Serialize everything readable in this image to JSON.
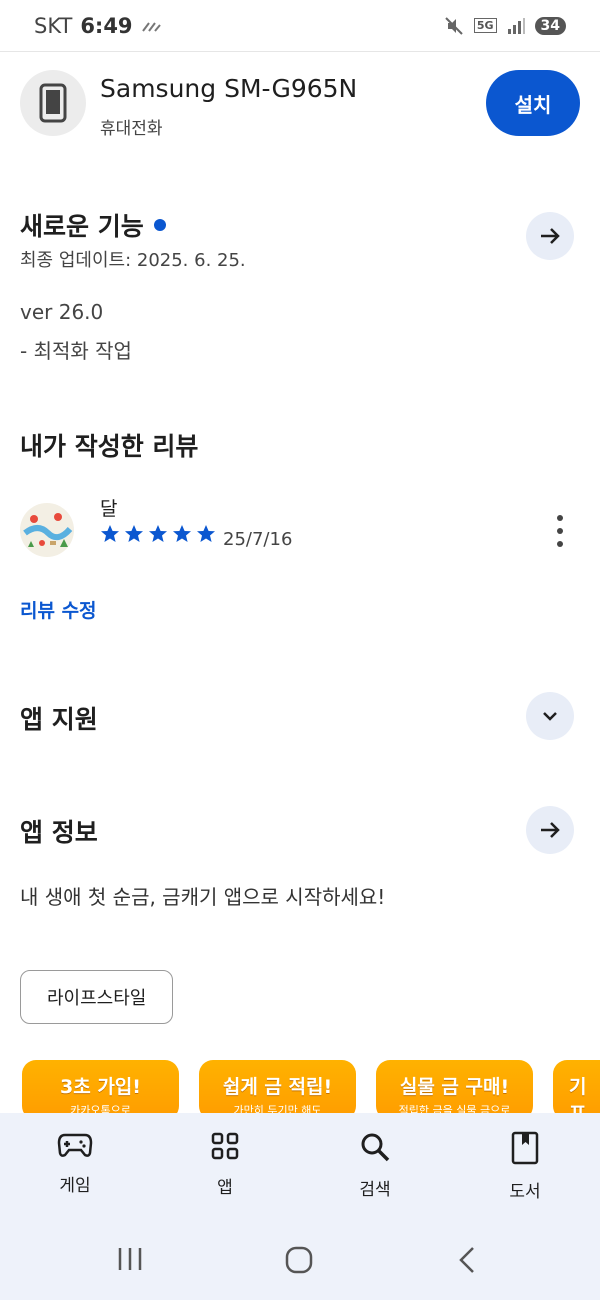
{
  "status_bar": {
    "carrier": "SKT",
    "time": "6:49",
    "battery": "34",
    "network": "5G"
  },
  "device": {
    "name": "Samsung SM-G965N",
    "type": "휴대전화",
    "install_label": "설치"
  },
  "whats_new": {
    "title": "새로운 기능",
    "last_update": "최종 업데이트: 2025. 6. 25.",
    "version": "ver 26.0",
    "note": "- 최적화 작업"
  },
  "my_review": {
    "title": "내가 작성한 리뷰",
    "author": "달",
    "rating": 5,
    "date": "25/7/16",
    "edit_label": "리뷰 수정"
  },
  "app_support": {
    "title": "앱 지원"
  },
  "app_info": {
    "title": "앱 정보",
    "description": "내 생애 첫 순금, 금캐기 앱으로 시작하세요!",
    "category": "라이프스타일"
  },
  "banners": [
    {
      "title": "3초 가입!",
      "subtitle": "카카오톡으로"
    },
    {
      "title": "쉽게 금 적립!",
      "subtitle": "가만히 두기만 해도"
    },
    {
      "title": "실물 금 구매!",
      "subtitle": "적립한 금을 실물 금으로"
    },
    {
      "title": "기프",
      "subtitle": "소중"
    }
  ],
  "bottom_nav": [
    {
      "label": "게임",
      "icon": "gamepad-icon"
    },
    {
      "label": "앱",
      "icon": "apps-grid-icon"
    },
    {
      "label": "검색",
      "icon": "search-icon"
    },
    {
      "label": "도서",
      "icon": "book-icon"
    }
  ],
  "colors": {
    "accent": "#0b57d0",
    "banner": "#ffa800",
    "nav_bg": "#eef2fa"
  }
}
